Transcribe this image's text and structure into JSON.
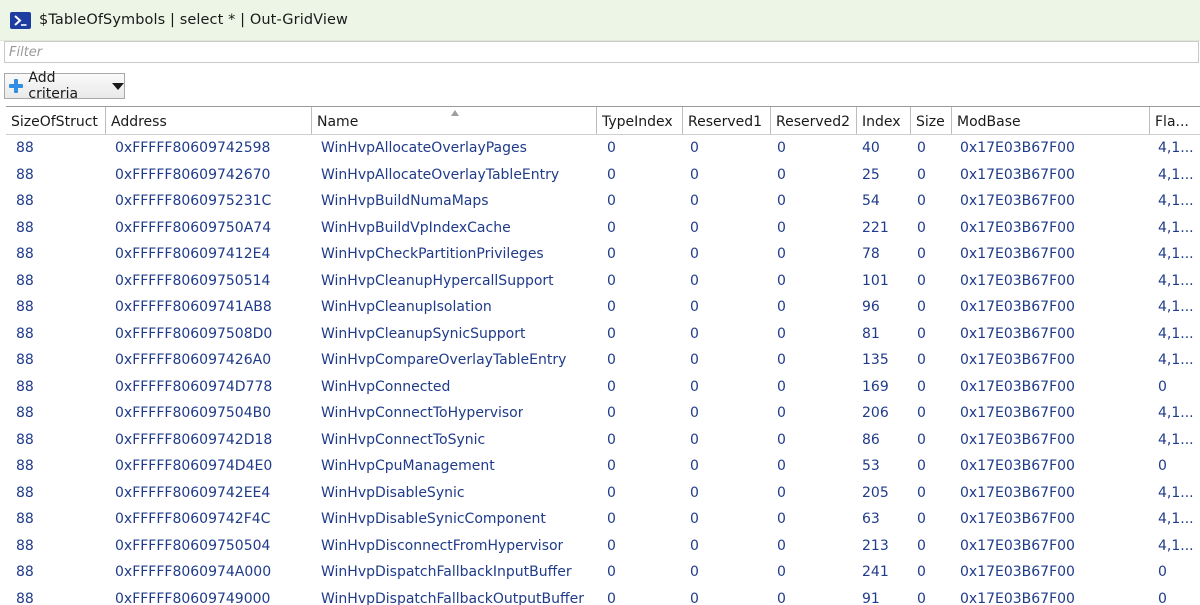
{
  "window": {
    "title": "$TableOfSymbols | select * | Out-GridView"
  },
  "filter": {
    "placeholder": "Filter",
    "value": ""
  },
  "toolbar": {
    "add_criteria_label": "Add criteria"
  },
  "table": {
    "sorted_column": "Name",
    "sort_direction": "ascending",
    "columns": [
      "SizeOfStruct",
      "Address",
      "Name",
      "TypeIndex",
      "Reserved1",
      "Reserved2",
      "Index",
      "Size",
      "ModBase",
      "Fla..."
    ],
    "rows": [
      [
        "88",
        "0xFFFFF80609742598",
        "WinHvpAllocateOverlayPages",
        "0",
        "0",
        "0",
        "40",
        "0",
        "0x17E03B67F00",
        "4,1..."
      ],
      [
        "88",
        "0xFFFFF80609742670",
        "WinHvpAllocateOverlayTableEntry",
        "0",
        "0",
        "0",
        "25",
        "0",
        "0x17E03B67F00",
        "4,1..."
      ],
      [
        "88",
        "0xFFFFF8060975231C",
        "WinHvpBuildNumaMaps",
        "0",
        "0",
        "0",
        "54",
        "0",
        "0x17E03B67F00",
        "4,1..."
      ],
      [
        "88",
        "0xFFFFF80609750A74",
        "WinHvpBuildVpIndexCache",
        "0",
        "0",
        "0",
        "221",
        "0",
        "0x17E03B67F00",
        "4,1..."
      ],
      [
        "88",
        "0xFFFFF806097412E4",
        "WinHvpCheckPartitionPrivileges",
        "0",
        "0",
        "0",
        "78",
        "0",
        "0x17E03B67F00",
        "4,1..."
      ],
      [
        "88",
        "0xFFFFF80609750514",
        "WinHvpCleanupHypercallSupport",
        "0",
        "0",
        "0",
        "101",
        "0",
        "0x17E03B67F00",
        "4,1..."
      ],
      [
        "88",
        "0xFFFFF80609741AB8",
        "WinHvpCleanupIsolation",
        "0",
        "0",
        "0",
        "96",
        "0",
        "0x17E03B67F00",
        "4,1..."
      ],
      [
        "88",
        "0xFFFFF806097508D0",
        "WinHvpCleanupSynicSupport",
        "0",
        "0",
        "0",
        "81",
        "0",
        "0x17E03B67F00",
        "4,1..."
      ],
      [
        "88",
        "0xFFFFF806097426A0",
        "WinHvpCompareOverlayTableEntry",
        "0",
        "0",
        "0",
        "135",
        "0",
        "0x17E03B67F00",
        "4,1..."
      ],
      [
        "88",
        "0xFFFFF8060974D778",
        "WinHvpConnected",
        "0",
        "0",
        "0",
        "169",
        "0",
        "0x17E03B67F00",
        "0"
      ],
      [
        "88",
        "0xFFFFF806097504B0",
        "WinHvpConnectToHypervisor",
        "0",
        "0",
        "0",
        "206",
        "0",
        "0x17E03B67F00",
        "4,1..."
      ],
      [
        "88",
        "0xFFFFF80609742D18",
        "WinHvpConnectToSynic",
        "0",
        "0",
        "0",
        "86",
        "0",
        "0x17E03B67F00",
        "4,1..."
      ],
      [
        "88",
        "0xFFFFF8060974D4E0",
        "WinHvpCpuManagement",
        "0",
        "0",
        "0",
        "53",
        "0",
        "0x17E03B67F00",
        "0"
      ],
      [
        "88",
        "0xFFFFF80609742EE4",
        "WinHvpDisableSynic",
        "0",
        "0",
        "0",
        "205",
        "0",
        "0x17E03B67F00",
        "4,1..."
      ],
      [
        "88",
        "0xFFFFF80609742F4C",
        "WinHvpDisableSynicComponent",
        "0",
        "0",
        "0",
        "63",
        "0",
        "0x17E03B67F00",
        "4,1..."
      ],
      [
        "88",
        "0xFFFFF80609750504",
        "WinHvpDisconnectFromHypervisor",
        "0",
        "0",
        "0",
        "213",
        "0",
        "0x17E03B67F00",
        "4,1..."
      ],
      [
        "88",
        "0xFFFFF8060974A000",
        "WinHvpDispatchFallbackInputBuffer",
        "0",
        "0",
        "0",
        "241",
        "0",
        "0x17E03B67F00",
        "0"
      ],
      [
        "88",
        "0xFFFFF80609749000",
        "WinHvpDispatchFallbackOutputBuffer",
        "0",
        "0",
        "0",
        "91",
        "0",
        "0x17E03B67F00",
        "0"
      ]
    ]
  }
}
